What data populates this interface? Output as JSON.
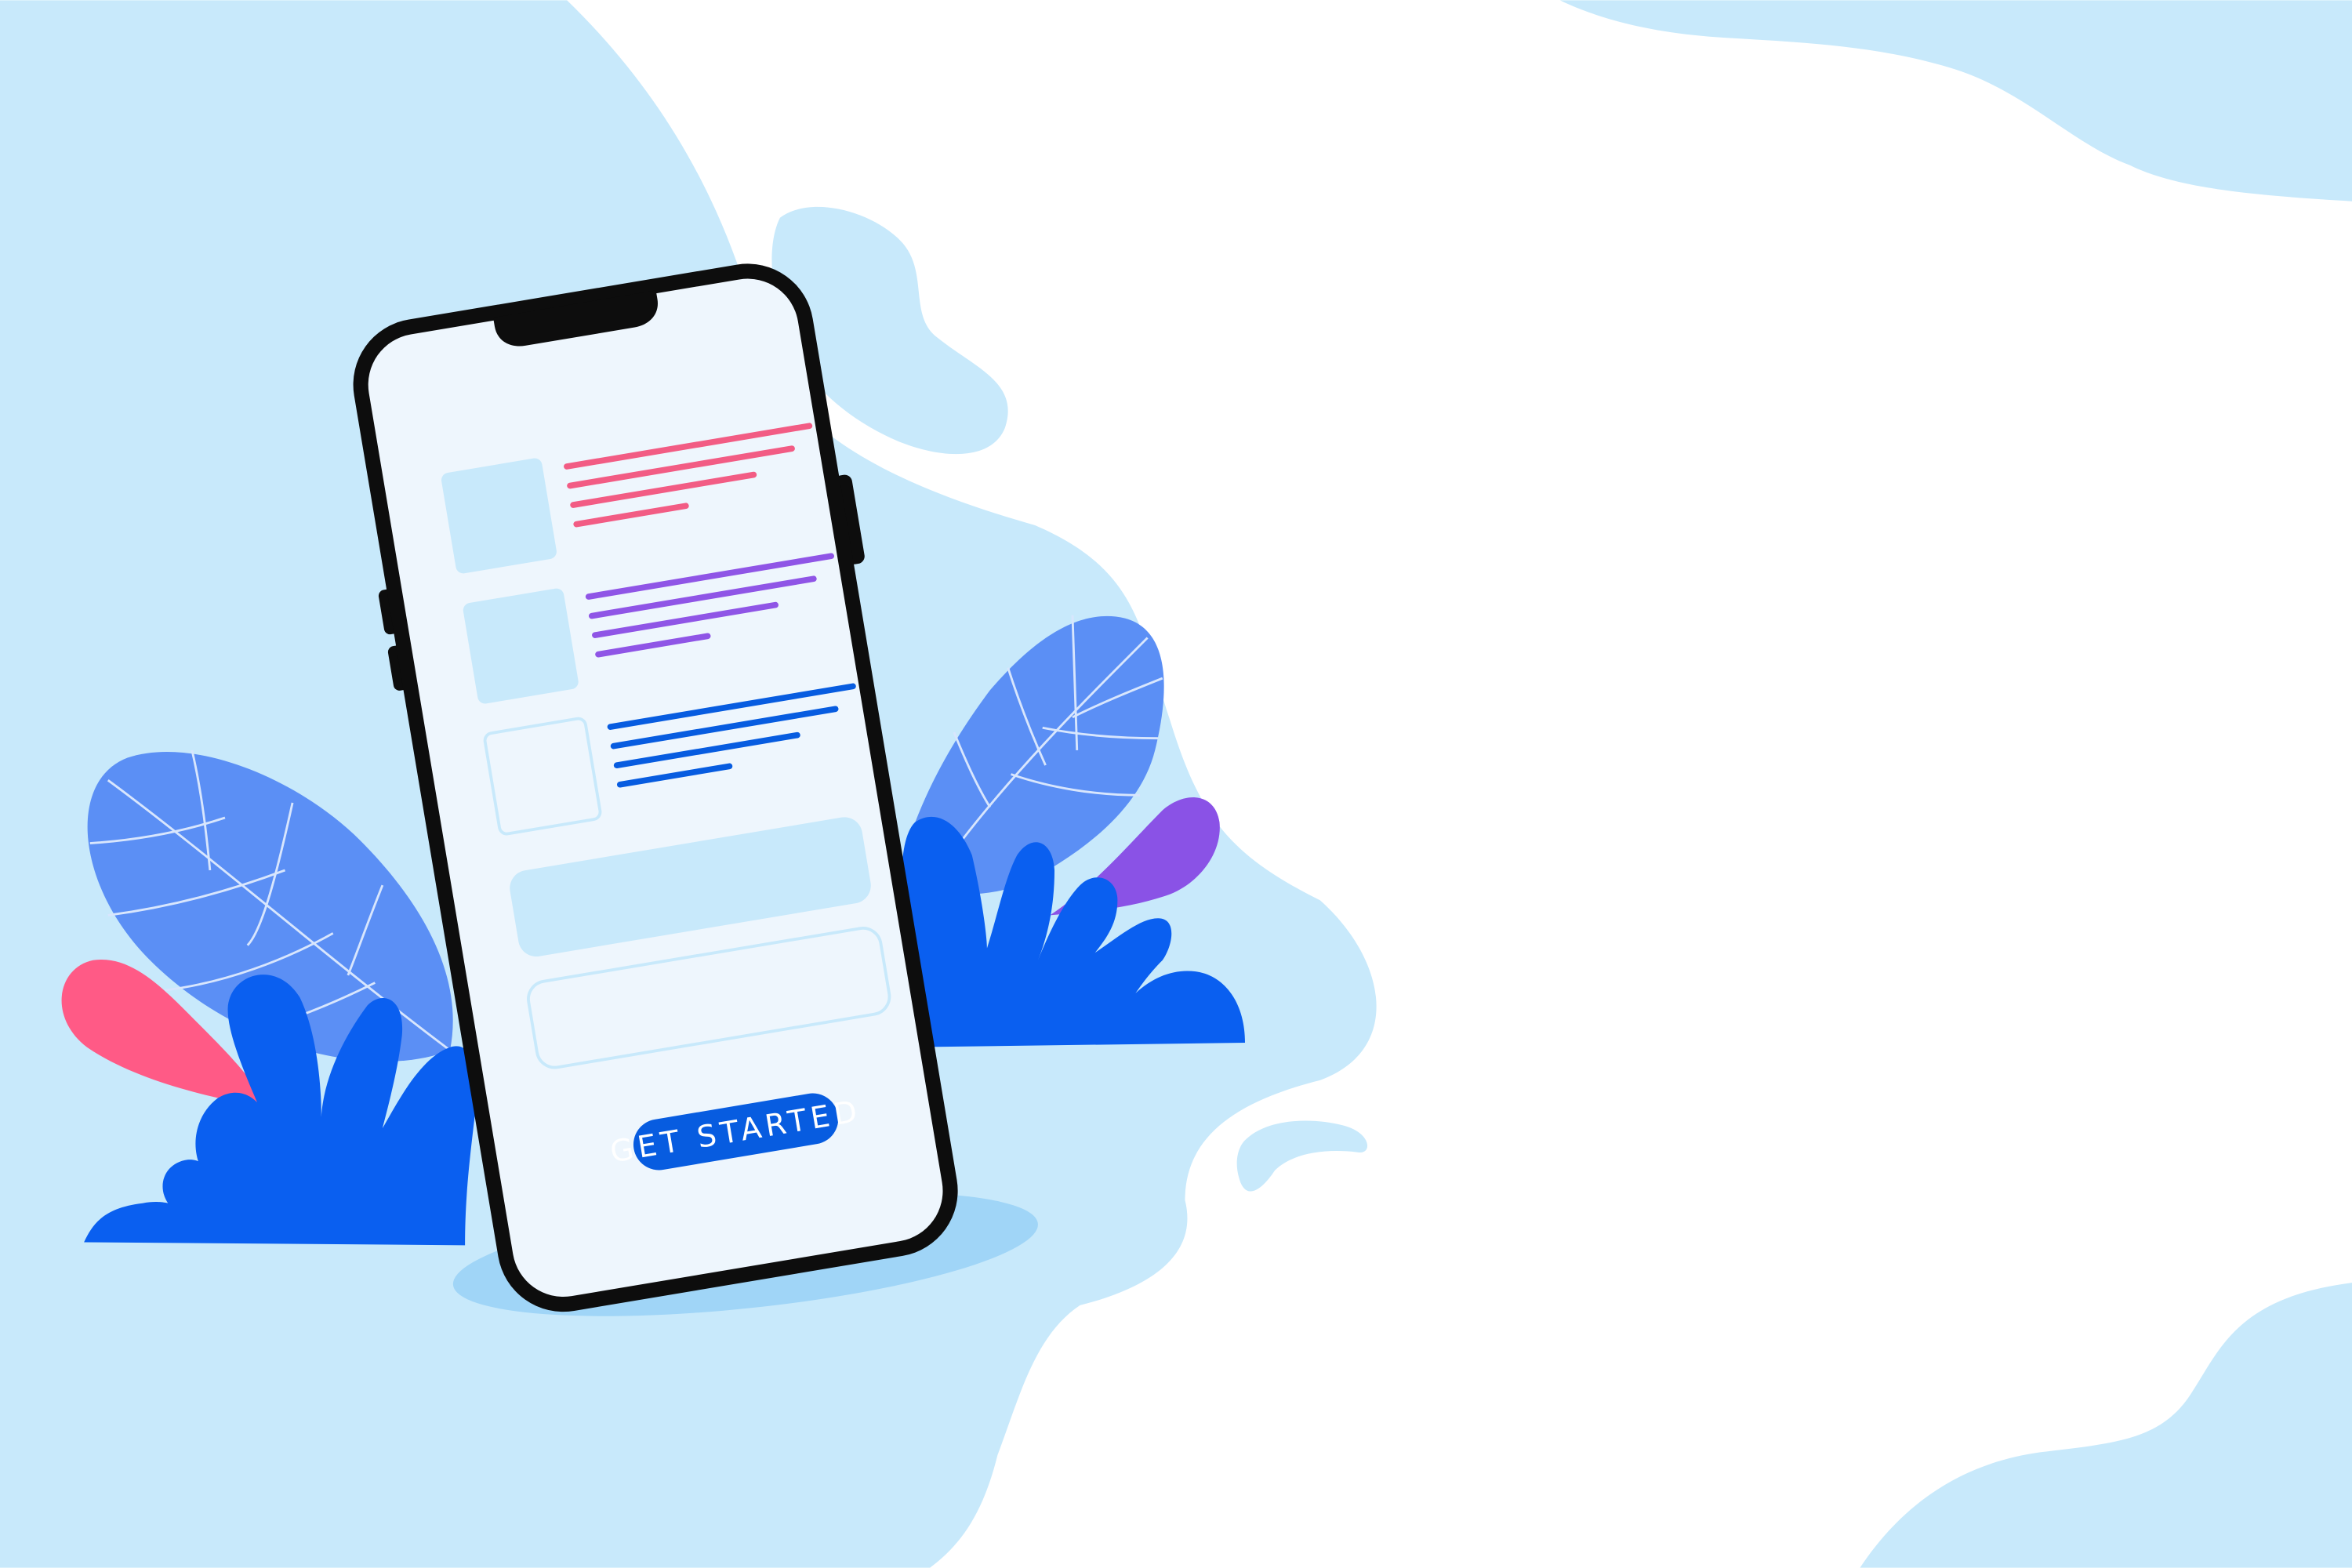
{
  "illustration": {
    "background_color": "#ffffff",
    "blob_color": "#c8e9fb",
    "floor_shadow_color": "#a0d5f7"
  },
  "phone": {
    "frame_color": "#0d0d0d",
    "screen_color": "#eef6fd",
    "list_items": [
      {
        "thumbnail_style": "filled",
        "line_color": "#f25c84",
        "line_count": 4
      },
      {
        "thumbnail_style": "filled",
        "line_color": "#8f55e6",
        "line_count": 4
      },
      {
        "thumbnail_style": "outlined",
        "line_color": "#075ce0",
        "line_count": 4
      }
    ],
    "input_fields": [
      {
        "style": "filled",
        "value": ""
      },
      {
        "style": "outlined",
        "value": ""
      }
    ],
    "cta_button": {
      "label": "GET STARTED",
      "background": "#075ce0",
      "text_color": "#ffffff"
    }
  },
  "plants": {
    "big_leaf_color": "#5b8ff5",
    "leaf_vein_color": "#d8e6fd",
    "bush_color": "#0a5ff0",
    "pink_petal_color": "#ff5a86",
    "purple_petal_color": "#8a52e6"
  },
  "icons": {
    "phone": "smartphone-icon",
    "notch": "phone-notch-icon",
    "leaves": "leaf-icon",
    "bushes": "plant-icon"
  }
}
